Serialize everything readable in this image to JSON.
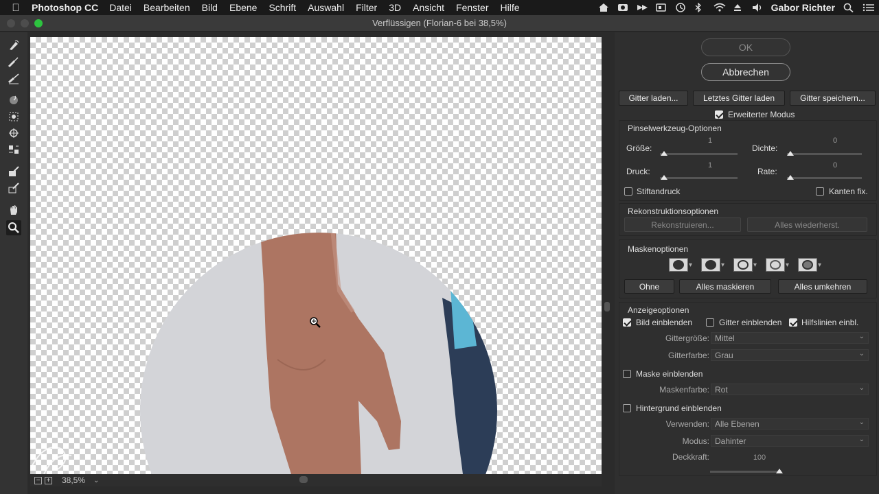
{
  "menubar": {
    "app_name": "Photoshop CC",
    "items": [
      "Datei",
      "Bearbeiten",
      "Bild",
      "Ebene",
      "Schrift",
      "Auswahl",
      "Filter",
      "3D",
      "Ansicht",
      "Fenster",
      "Hilfe"
    ],
    "user": "Gabor Richter"
  },
  "window": {
    "title": "Verflüssigen (Florian-6 bei 38,5%)"
  },
  "status": {
    "zoom": "38,5%",
    "minus": "−",
    "plus": "+"
  },
  "panel": {
    "ok_label": "OK",
    "cancel_label": "Abbrechen",
    "load_mesh": "Gitter laden...",
    "load_last_mesh": "Letztes Gitter laden",
    "save_mesh": "Gitter speichern...",
    "advanced_mode": {
      "label": "Erweiterter Modus",
      "checked": true
    },
    "brush_options": {
      "title": "Pinselwerkzeug-Optionen",
      "size_label": "Größe:",
      "size_value": "1",
      "density_label": "Dichte:",
      "density_value": "0",
      "pressure_label": "Druck:",
      "pressure_value": "1",
      "rate_label": "Rate:",
      "rate_value": "0",
      "stylus_label": "Stiftandruck",
      "pin_edges_label": "Kanten fix."
    },
    "reconstruct": {
      "title": "Rekonstruktionsoptionen",
      "reconstruct_label": "Rekonstruieren...",
      "restore_all_label": "Alles wiederherst."
    },
    "mask": {
      "title": "Maskenoptionen",
      "none_label": "Ohne",
      "mask_all_label": "Alles maskieren",
      "invert_all_label": "Alles umkehren"
    },
    "view": {
      "title": "Anzeigeoptionen",
      "show_image": {
        "label": "Bild einblenden",
        "checked": true
      },
      "show_mesh": {
        "label": "Gitter einblenden",
        "checked": false
      },
      "show_guides": {
        "label": "Hilfslinien einbl.",
        "checked": true
      },
      "mesh_size_label": "Gittergröße:",
      "mesh_size_value": "Mittel",
      "mesh_color_label": "Gitterfarbe:",
      "mesh_color_value": "Grau",
      "show_mask": {
        "label": "Maske einblenden",
        "checked": false
      },
      "mask_color_label": "Maskenfarbe:",
      "mask_color_value": "Rot",
      "show_backdrop": {
        "label": "Hintergrund einblenden",
        "checked": false
      },
      "use_label": "Verwenden:",
      "use_value": "Alle Ebenen",
      "mode_label": "Modus:",
      "mode_value": "Dahinter",
      "opacity_label": "Deckkraft:",
      "opacity_value": "100"
    }
  },
  "colors": {
    "panel_bg": "#2f2f2f",
    "canvas_circle": "#d2d3d7",
    "skin": "#b07a66",
    "jeans": "#2c3d57"
  },
  "icons": [
    "apple-icon",
    "forward-warp-tool-icon",
    "reconstruct-tool-icon",
    "smooth-tool-icon",
    "twirl-tool-icon",
    "pucker-tool-icon",
    "bloat-tool-icon",
    "push-left-tool-icon",
    "freeze-mask-tool-icon",
    "thaw-mask-tool-icon",
    "hand-tool-icon",
    "zoom-tool-icon"
  ]
}
